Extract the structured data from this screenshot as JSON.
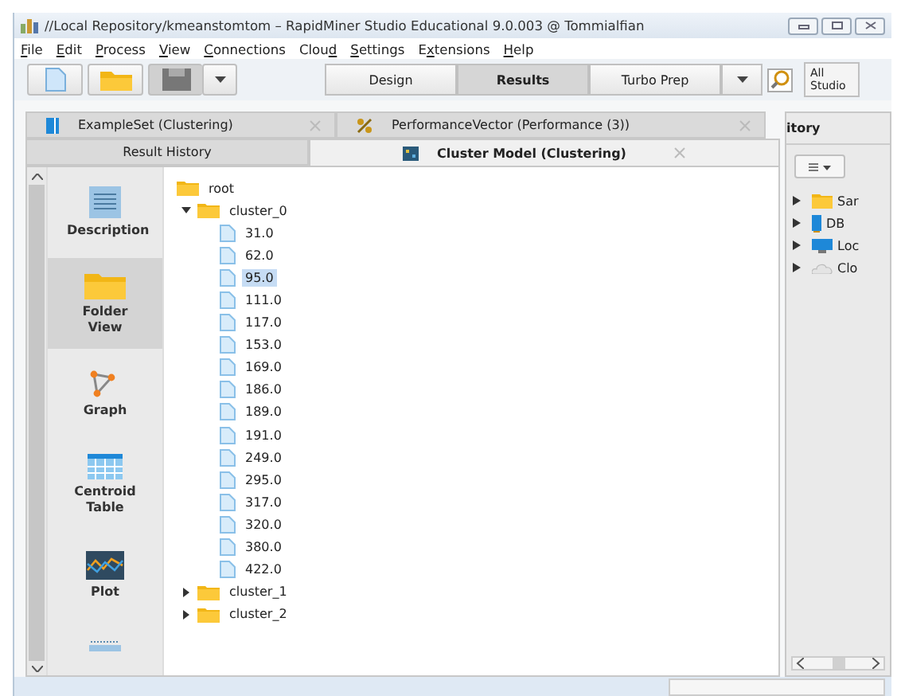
{
  "window": {
    "title": "//Local Repository/kmeanstomtom – RapidMiner Studio Educational 9.0.003 @ Tommialfian"
  },
  "menu": [
    {
      "key": "F",
      "post": "ile"
    },
    {
      "key": "E",
      "post": "dit"
    },
    {
      "key": "P",
      "post": "rocess"
    },
    {
      "key": "V",
      "post": "iew"
    },
    {
      "key": "C",
      "post": "onnections"
    },
    {
      "pre": "Clou",
      "key": "d"
    },
    {
      "key": "S",
      "post": "ettings"
    },
    {
      "pre": "E",
      "key": "x",
      "post": "tensions"
    },
    {
      "key": "H",
      "post": "elp"
    }
  ],
  "perspectives": [
    {
      "label": "Design",
      "selected": false
    },
    {
      "label": "Results",
      "selected": true
    },
    {
      "label": "Turbo Prep",
      "selected": false
    }
  ],
  "scope": {
    "line1": "All",
    "line2": "Studio"
  },
  "result_tabs": [
    {
      "label": "ExampleSet (Clustering)",
      "kind": "table"
    },
    {
      "label": "PerformanceVector (Performance (3))",
      "kind": "percent"
    }
  ],
  "view_tabs": [
    {
      "label": "Result History",
      "selected": false
    },
    {
      "label": "Cluster Model (Clustering)",
      "selected": true
    }
  ],
  "views": [
    {
      "label": "Description",
      "kind": "description",
      "selected": false
    },
    {
      "label": "Folder View",
      "kind": "folder",
      "selected": true
    },
    {
      "label": "Graph",
      "kind": "graph",
      "selected": false
    },
    {
      "label": "Centroid Table",
      "kind": "table",
      "selected": false
    },
    {
      "label": "Plot",
      "kind": "plot",
      "selected": false
    },
    {
      "kind": "list"
    }
  ],
  "tree": {
    "label": "root",
    "children": [
      {
        "label": "cluster_0",
        "expanded": true,
        "children": [
          {
            "label": "31.0",
            "selected": false
          },
          {
            "label": "62.0",
            "selected": false
          },
          {
            "label": "95.0",
            "selected": true
          },
          {
            "label": "111.0",
            "selected": false
          },
          {
            "label": "117.0",
            "selected": false
          },
          {
            "label": "153.0",
            "selected": false
          },
          {
            "label": "169.0",
            "selected": false
          },
          {
            "label": "186.0",
            "selected": false
          },
          {
            "label": "189.0",
            "selected": false
          },
          {
            "label": "191.0",
            "selected": false
          },
          {
            "label": "249.0",
            "selected": false
          },
          {
            "label": "295.0",
            "selected": false
          },
          {
            "label": "317.0",
            "selected": false
          },
          {
            "label": "320.0",
            "selected": false
          },
          {
            "label": "380.0",
            "selected": false
          },
          {
            "label": "422.0",
            "selected": false
          }
        ]
      },
      {
        "label": "cluster_1",
        "expanded": false
      },
      {
        "label": "cluster_2",
        "expanded": false
      }
    ]
  },
  "repository": {
    "title": "itory",
    "items": [
      {
        "label": "Sar",
        "kind": "folder"
      },
      {
        "label": "DB",
        "kind": "database"
      },
      {
        "label": "Loc",
        "kind": "monitor"
      },
      {
        "label": "Clo",
        "kind": "cloud"
      }
    ]
  }
}
